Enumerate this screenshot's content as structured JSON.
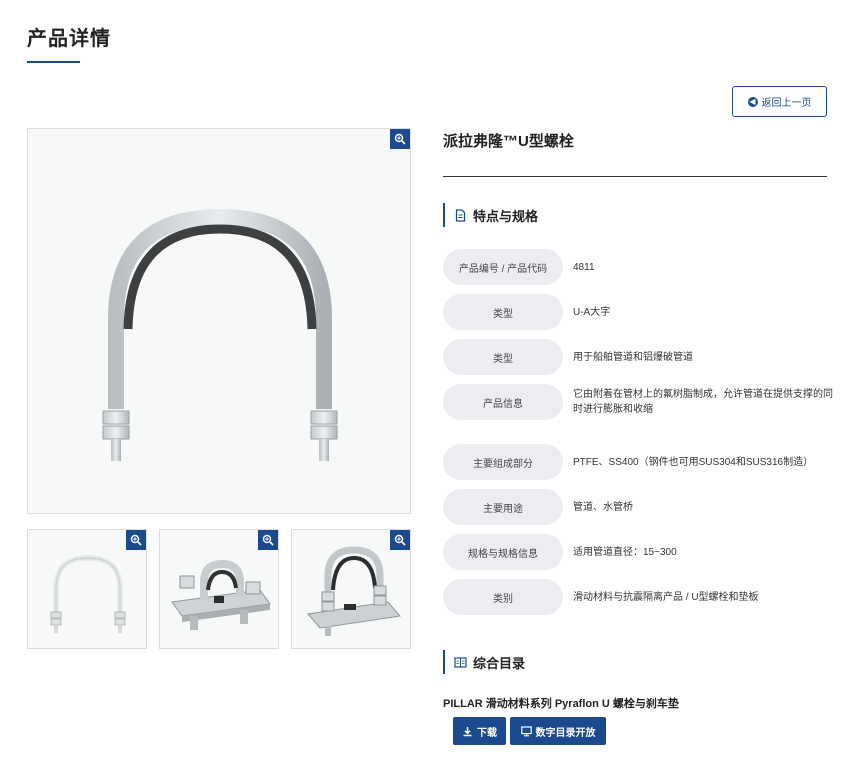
{
  "page": {
    "title": "产品详情"
  },
  "nav": {
    "back_label": "返回上一页"
  },
  "product": {
    "name": "派拉弗隆™U型螺栓"
  },
  "features": {
    "heading": "特点与规格",
    "rows": [
      {
        "label": "产品编号 / 产品代码",
        "value": "4811"
      },
      {
        "label": "类型",
        "value": "U-A大字"
      },
      {
        "label": "类型",
        "value": "用于船舶管道和铝爆破管道"
      },
      {
        "label": "产品信息",
        "value": "它由附着在管材上的氟树脂制成，允许管道在提供支撑的同时进行膨胀和收缩"
      },
      {
        "label": "主要组成部分",
        "value": "PTFE、SS400（钢件也可用SUS304和SUS316制造）"
      },
      {
        "label": "主要用途",
        "value": "管道、水管桥"
      },
      {
        "label": "规格与规格信息",
        "value": "适用管道直径：15~300"
      },
      {
        "label": "类别",
        "value": "滑动材料与抗震隔离产品 / U型螺栓和垫板"
      }
    ]
  },
  "catalog": {
    "heading": "综合目录",
    "title": "PILLAR 滑动材料系列 Pyraflon U 螺栓与刹车垫",
    "download_label": "下载",
    "digital_label": "数字目录开放"
  },
  "colors": {
    "accent": "#1c4a8f",
    "label_bg": "#ebedf0"
  },
  "icons": [
    "zoom-in-icon",
    "arrow-left-icon",
    "document-icon",
    "book-icon",
    "download-icon",
    "monitor-icon"
  ]
}
